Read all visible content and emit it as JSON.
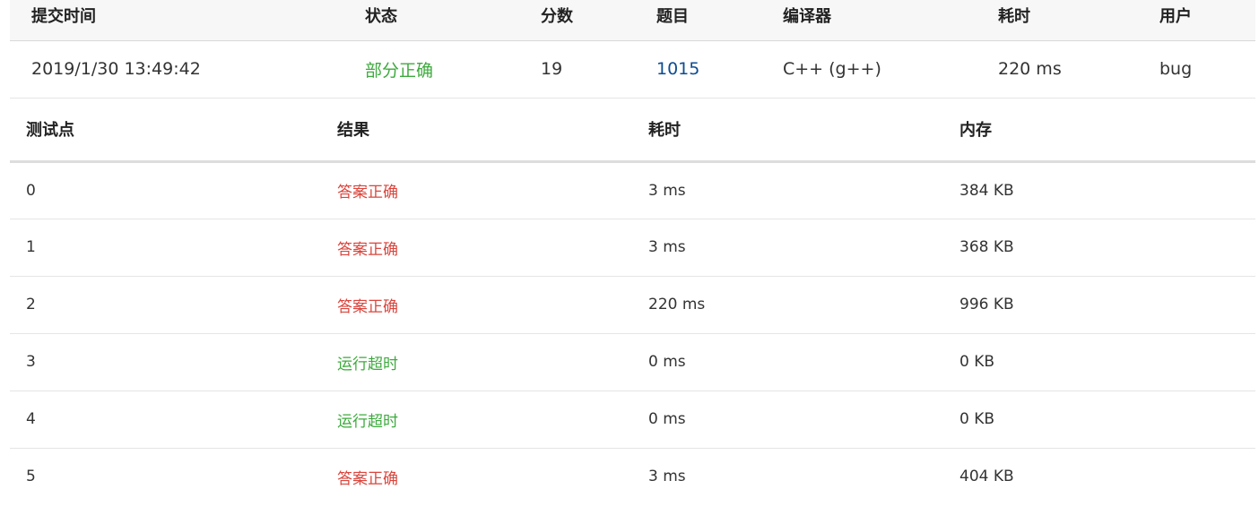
{
  "submission": {
    "headers": {
      "time": "提交时间",
      "status": "状态",
      "score": "分数",
      "problem": "题目",
      "compiler": "编译器",
      "cost": "耗时",
      "user": "用户"
    },
    "row": {
      "time": "2019/1/30 13:49:42",
      "status": "部分正确",
      "score": "19",
      "problem": "1015",
      "compiler": "C++ (g++)",
      "cost": "220 ms",
      "user": "bug"
    },
    "colors": {
      "status": "#3daa3d",
      "problem_link": "#0e4c92"
    }
  },
  "testcases": {
    "headers": {
      "case": "测试点",
      "result": "结果",
      "time": "耗时",
      "memory": "内存"
    },
    "rows": [
      {
        "case": "0",
        "result": "答案正确",
        "time": "3 ms",
        "memory": "384 KB",
        "result_kind": "correct"
      },
      {
        "case": "1",
        "result": "答案正确",
        "time": "3 ms",
        "memory": "368 KB",
        "result_kind": "correct"
      },
      {
        "case": "2",
        "result": "答案正确",
        "time": "220 ms",
        "memory": "996 KB",
        "result_kind": "correct"
      },
      {
        "case": "3",
        "result": "运行超时",
        "time": "0 ms",
        "memory": "0 KB",
        "result_kind": "tle"
      },
      {
        "case": "4",
        "result": "运行超时",
        "time": "0 ms",
        "memory": "0 KB",
        "result_kind": "tle"
      },
      {
        "case": "5",
        "result": "答案正确",
        "time": "3 ms",
        "memory": "404 KB",
        "result_kind": "correct"
      }
    ],
    "colors": {
      "correct": "#d9453c",
      "tle": "#3daa3d"
    }
  }
}
